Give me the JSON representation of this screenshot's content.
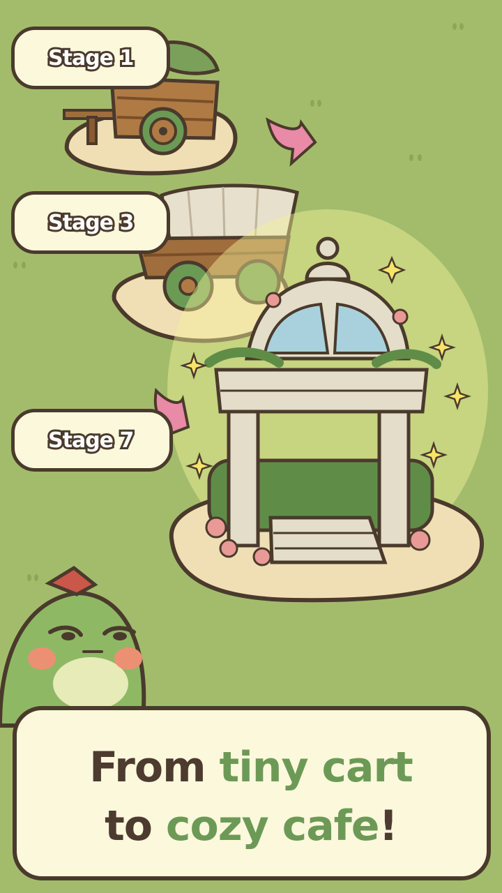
{
  "stages": [
    {
      "label": "Stage 1",
      "item": "cart"
    },
    {
      "label": "Stage 3",
      "item": "covered-wagon"
    },
    {
      "label": "Stage 7",
      "item": "gazebo"
    }
  ],
  "caption": {
    "line1_plain": "From ",
    "line1_highlight": "tiny cart",
    "line2_plain": "to ",
    "line2_highlight": "cozy cafe",
    "line2_end": "!"
  },
  "colors": {
    "background": "#a3bc6c",
    "outline": "#4a3a2c",
    "cream": "#fbf8dc",
    "highlight": "#6c9a56",
    "arrow": "#e98aa6"
  }
}
